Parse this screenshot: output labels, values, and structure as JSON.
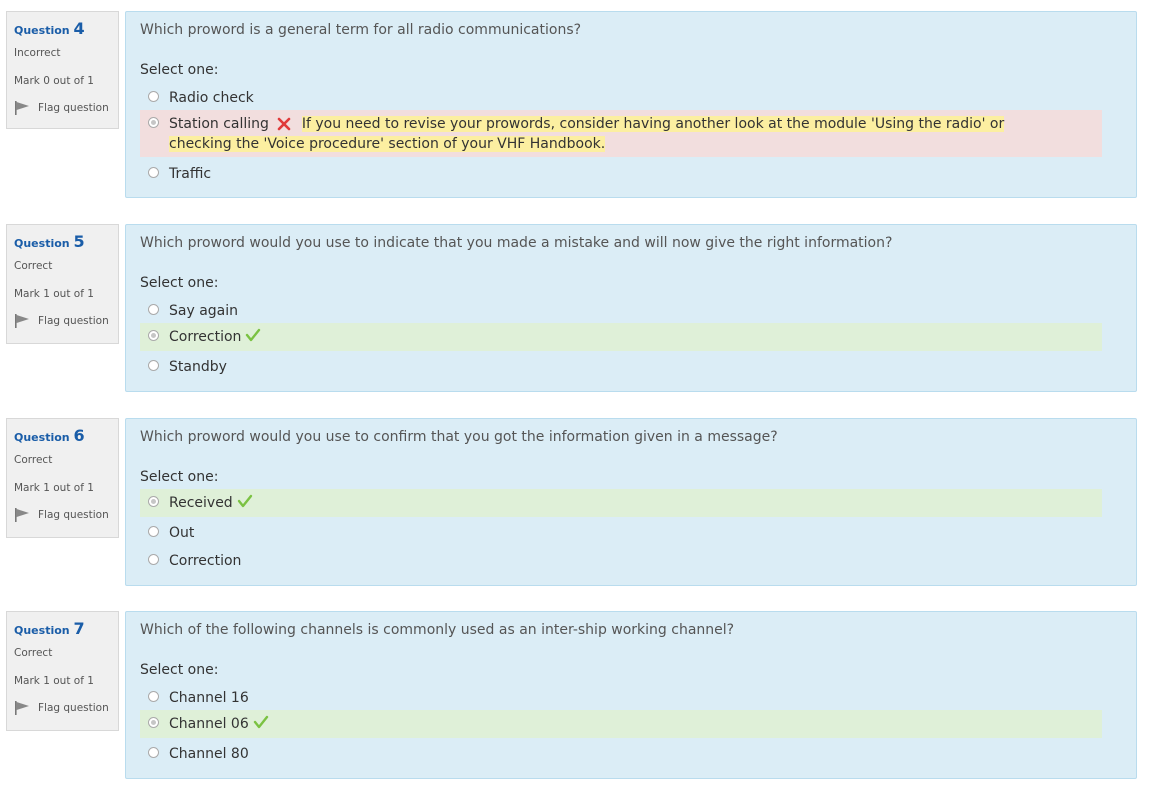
{
  "labels": {
    "question": "Question",
    "select_one": "Select one:",
    "mark_prefix": "Mark"
  },
  "colors": {
    "correct_bg": "#dff0d8",
    "incorrect_bg": "#f2dede",
    "content_bg": "#dbedf6",
    "feedback_bg": "#fcefa1",
    "question_number": "#1a5da8"
  },
  "questions": [
    {
      "number": "4",
      "state": "Incorrect",
      "grade": "Mark 0 out of 1",
      "flag_label": "Flag question",
      "text": "Which proword is a general term for all radio communications?",
      "answers": [
        {
          "label": "Radio check",
          "selected": false,
          "status": "none"
        },
        {
          "label": "Station calling",
          "selected": true,
          "status": "incorrect",
          "feedback": "If you need to revise your prowords, consider having another look at the module 'Using the radio' or checking the 'Voice procedure' section of your VHF Handbook."
        },
        {
          "label": "Traffic",
          "selected": false,
          "status": "none"
        }
      ]
    },
    {
      "number": "5",
      "state": "Correct",
      "grade": "Mark 1 out of 1",
      "flag_label": "Flag question",
      "text": "Which proword would you use to indicate that you made a mistake and will now give the right information?",
      "answers": [
        {
          "label": "Say again",
          "selected": false,
          "status": "none"
        },
        {
          "label": "Correction",
          "selected": true,
          "status": "correct"
        },
        {
          "label": "Standby",
          "selected": false,
          "status": "none"
        }
      ]
    },
    {
      "number": "6",
      "state": "Correct",
      "grade": "Mark 1 out of 1",
      "flag_label": "Flag question",
      "text": "Which proword would you use to confirm that you got the information given in a message?",
      "answers": [
        {
          "label": "Received",
          "selected": true,
          "status": "correct"
        },
        {
          "label": "Out",
          "selected": false,
          "status": "none"
        },
        {
          "label": "Correction",
          "selected": false,
          "status": "none"
        }
      ]
    },
    {
      "number": "7",
      "state": "Correct",
      "grade": "Mark 1 out of 1",
      "flag_label": "Flag question",
      "text": "Which of the following channels is commonly used as an inter-ship working channel?",
      "answers": [
        {
          "label": "Channel 16",
          "selected": false,
          "status": "none"
        },
        {
          "label": "Channel 06",
          "selected": true,
          "status": "correct"
        },
        {
          "label": "Channel 80",
          "selected": false,
          "status": "none"
        }
      ]
    }
  ]
}
